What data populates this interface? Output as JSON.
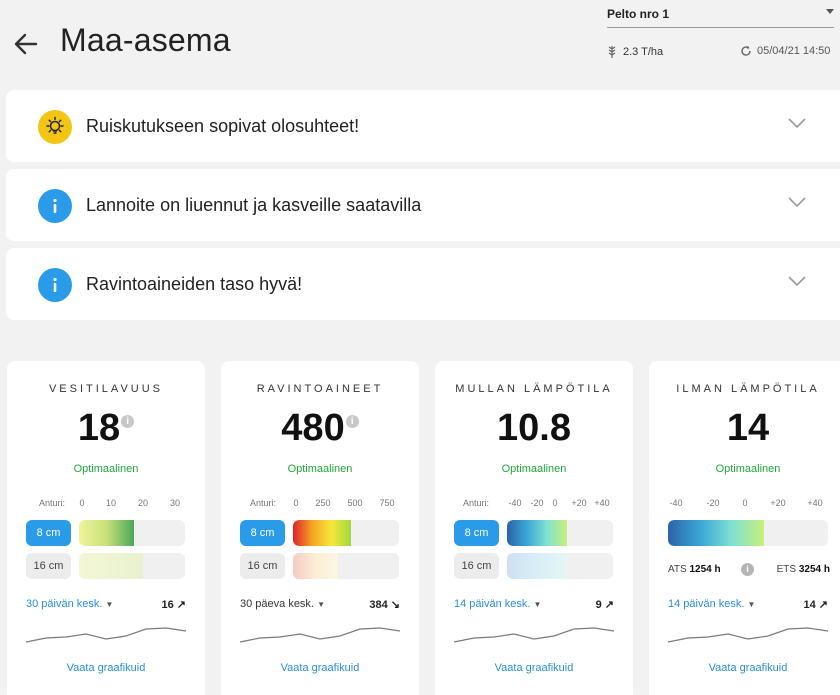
{
  "header": {
    "title": "Maa-asema",
    "field_select": {
      "value": "Pelto nro 1"
    },
    "yield": "2.3 T/ha",
    "updated": "05/04/21 14:50"
  },
  "alerts": [
    {
      "text": "Ruiskutukseen sopivat olosuhteet!",
      "icon": "lightbulb-icon",
      "color": "#f3c515"
    },
    {
      "text": "Lannoite on liuennut ja kasveille saatavilla",
      "icon": "info-icon",
      "color": "#2a9be8"
    },
    {
      "text": "Ravintoaineiden taso hyvä!",
      "icon": "info-icon",
      "color": "#2a9be8"
    }
  ],
  "colors": {
    "accent": "#2a9be8",
    "ok": "#1fa83a"
  },
  "cards": [
    {
      "title": "VESITILAVUUS",
      "value": "18",
      "status": "Optimaalinen",
      "scale": [
        "Anturi:",
        "0",
        "10",
        "20",
        "30"
      ],
      "depths": [
        {
          "label": "8 cm",
          "level": 0.52,
          "gradient": "linear-gradient(90deg,#eef59b,#c9e07a,#4aa85a)"
        },
        {
          "label": "16 cm",
          "level": 0.6,
          "gradient": "linear-gradient(90deg,#f4f7d6,#e8f1cf)"
        }
      ],
      "avg_label": "30 päivän kesk.",
      "avg_value": "16",
      "trend": "↗",
      "spark": [
        22,
        18,
        17,
        14,
        19,
        16,
        9,
        8,
        11
      ],
      "link": "Vaata graafikuid"
    },
    {
      "title": "RAVINTOAINEET",
      "value": "480",
      "status": "Optimaalinen",
      "scale": [
        "Anturi:",
        "0",
        "250",
        "500",
        "750"
      ],
      "depths": [
        {
          "label": "8 cm",
          "level": 0.55,
          "gradient": "linear-gradient(90deg,#e0222b,#f5a623,#f6e73a,#9fd83d)"
        },
        {
          "label": "16 cm",
          "level": 0.42,
          "gradient": "linear-gradient(90deg,#f8c9c4,#fbeed4,#fcf6e4)"
        }
      ],
      "avg_label": "30 päeva kesk.",
      "avg_value": "384",
      "trend": "↘",
      "spark": [
        22,
        18,
        17,
        14,
        19,
        16,
        9,
        8,
        11
      ],
      "link": "Vaata graafikuid"
    },
    {
      "title": "MULLAN LÄMPÖTILA",
      "value": "10.8",
      "status": "Optimaalinen",
      "scale": [
        "Anturi:",
        "-40",
        "-20",
        "0",
        "+20",
        "+40"
      ],
      "depths": [
        {
          "label": "8 cm",
          "level": 0.57,
          "gradient": "linear-gradient(90deg,#2a63a8,#3aa6d6,#7fe0d2,#c8f07a)"
        },
        {
          "label": "16 cm",
          "level": 0.57,
          "gradient": "linear-gradient(90deg,#cfe0f2,#d8eef7,#e4f7f5)"
        }
      ],
      "avg_label": "14 päivän kesk.",
      "avg_value": "9",
      "trend": "↗",
      "spark": [
        22,
        18,
        17,
        14,
        19,
        16,
        9,
        8,
        11
      ],
      "link": "Vaata graafikuid"
    },
    {
      "title": "ILMAN LÄMPÖTILA",
      "value": "14",
      "status": "Optimaalinen",
      "scale": [
        "-40",
        "-20",
        "0",
        "+20",
        "+40"
      ],
      "depths": [
        {
          "label": "",
          "level": 0.6,
          "gradient": "linear-gradient(90deg,#2a63a8,#3aa6d6,#7fe0d2,#c8f07a)"
        }
      ],
      "ats": {
        "ats_label": "ATS",
        "ats_value": "1254 h",
        "ets_label": "ETS",
        "ets_value": "3254 h"
      },
      "avg_label": "14 päivän kesk.",
      "avg_value": "14",
      "trend": "↗",
      "spark": [
        22,
        18,
        17,
        14,
        19,
        16,
        9,
        8,
        11
      ],
      "link": "Vaata graafikuid"
    }
  ]
}
